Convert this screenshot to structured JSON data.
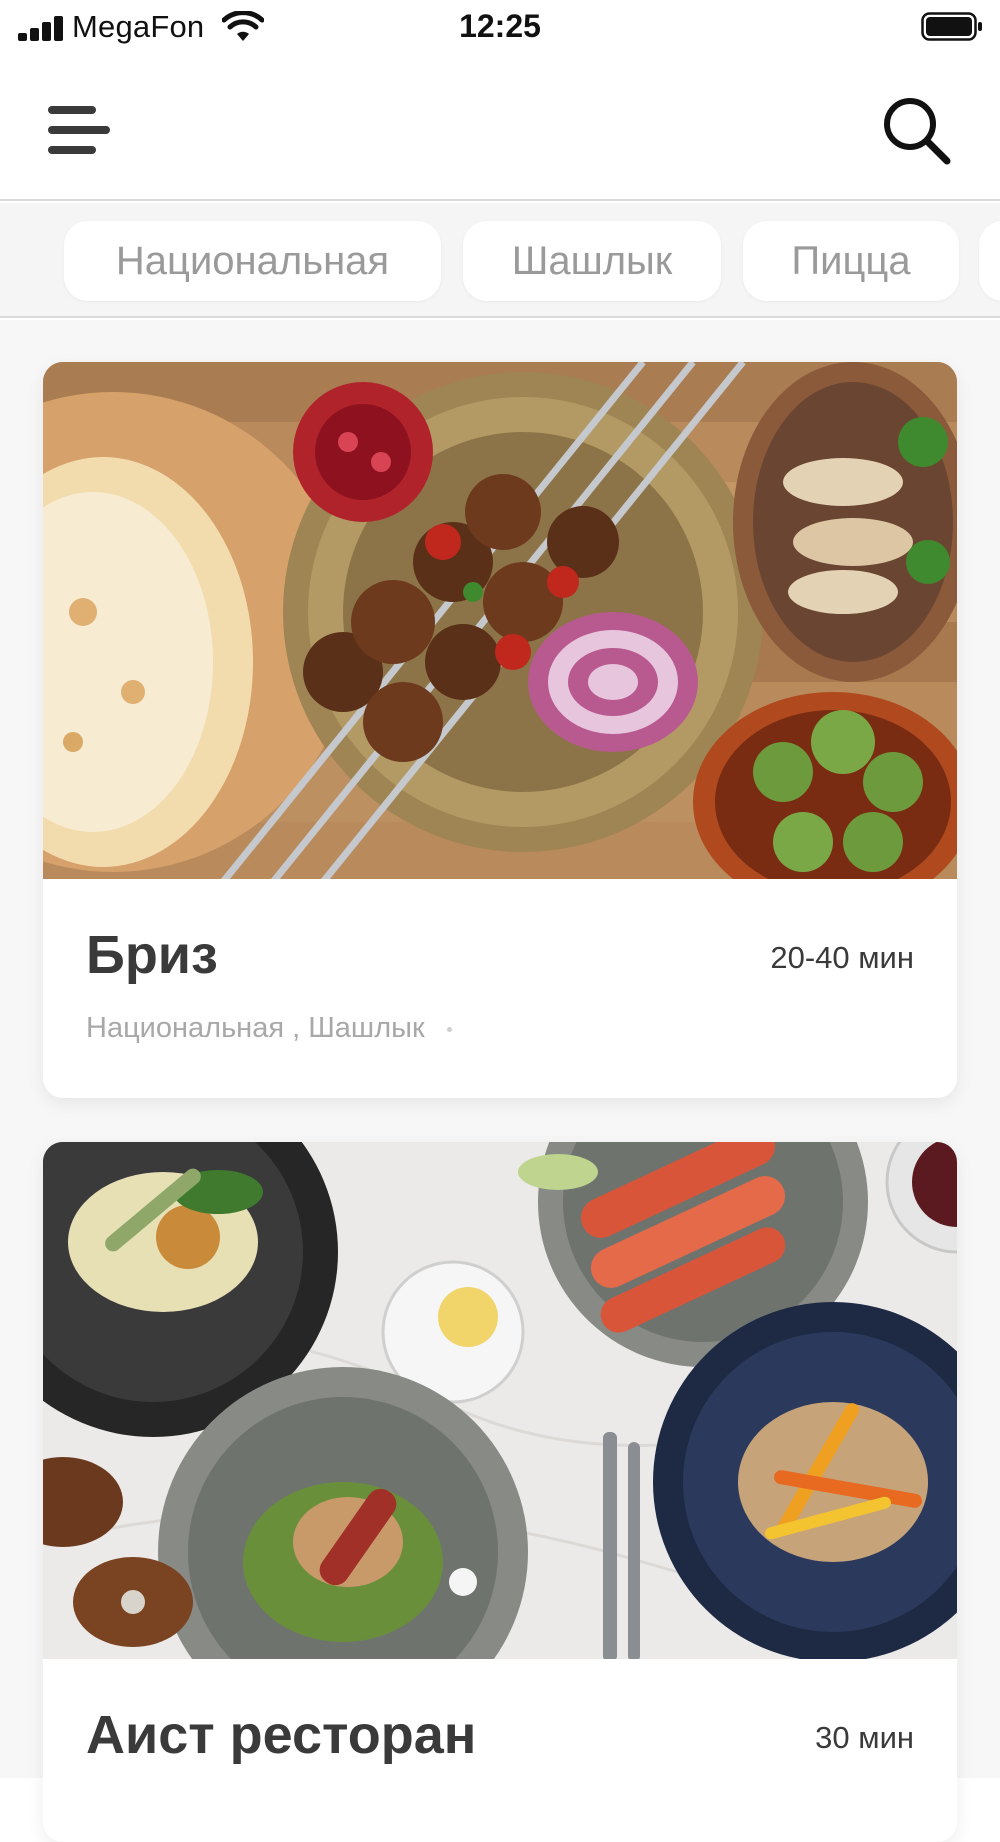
{
  "status_bar": {
    "carrier": "MegaFon",
    "time": "12:25",
    "signal_icon": "cellular-signal-icon",
    "wifi_icon": "wifi-icon",
    "battery_icon": "battery-icon"
  },
  "app_bar": {
    "menu_icon": "hamburger-menu-icon",
    "search_icon": "search-icon"
  },
  "categories": [
    {
      "label": "Национальная"
    },
    {
      "label": "Шашлык"
    },
    {
      "label": "Пицца"
    }
  ],
  "restaurants": [
    {
      "name": "Бриз",
      "delivery_time": "20-40 мин",
      "tags": [
        "Национальная",
        "Шашлык"
      ],
      "tag_separator": ","
    },
    {
      "name": "Аист ресторан",
      "delivery_time": "30 мин"
    }
  ],
  "colors": {
    "text_primary": "#3a3a3a",
    "text_secondary": "#a8a8a8",
    "chip_text": "#9a9a9a",
    "chips_background": "#f5f5f5",
    "card_background": "#ffffff"
  }
}
